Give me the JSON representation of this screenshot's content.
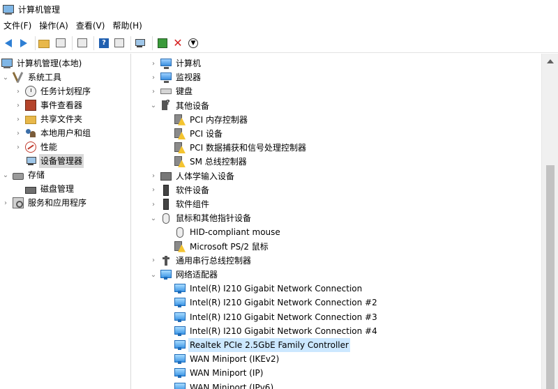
{
  "window": {
    "title": "计算机管理"
  },
  "menu": [
    "文件(F)",
    "操作(A)",
    "查看(V)",
    "帮助(H)"
  ],
  "toolbar": {
    "buttons": [
      "back-icon",
      "forward-icon",
      "up-folder-icon",
      "show-hide-tree-icon",
      "properties-icon",
      "help-icon",
      "show-action-pane-icon",
      "monitor-icon",
      "update-driver-icon",
      "uninstall-icon",
      "download-icon"
    ]
  },
  "left_tree": {
    "root": "计算机管理(本地)",
    "system_tools": "系统工具",
    "task_scheduler": "任务计划程序",
    "event_viewer": "事件查看器",
    "shared_folders": "共享文件夹",
    "local_users": "本地用户和组",
    "performance": "性能",
    "device_manager": "设备管理器",
    "storage": "存储",
    "disk_management": "磁盘管理",
    "services_apps": "服务和应用程序"
  },
  "device_tree": [
    {
      "label": "计算机",
      "level": 0,
      "expander": ">",
      "icon": "computer-monitor-icon"
    },
    {
      "label": "监视器",
      "level": 0,
      "expander": ">",
      "icon": "monitor-icon"
    },
    {
      "label": "键盘",
      "level": 0,
      "expander": ">",
      "icon": "keyboard-icon"
    },
    {
      "label": "其他设备",
      "level": 0,
      "expander": "v",
      "icon": "other-devices-icon"
    },
    {
      "label": "PCI 内存控制器",
      "level": 1,
      "expander": "",
      "icon": "warning-device-icon"
    },
    {
      "label": "PCI 设备",
      "level": 1,
      "expander": "",
      "icon": "warning-device-icon"
    },
    {
      "label": "PCI 数据捕获和信号处理控制器",
      "level": 1,
      "expander": "",
      "icon": "warning-device-icon"
    },
    {
      "label": "SM 总线控制器",
      "level": 1,
      "expander": "",
      "icon": "warning-device-icon"
    },
    {
      "label": "人体学输入设备",
      "level": 0,
      "expander": ">",
      "icon": "hid-icon"
    },
    {
      "label": "软件设备",
      "level": 0,
      "expander": ">",
      "icon": "software-device-icon"
    },
    {
      "label": "软件组件",
      "level": 0,
      "expander": ">",
      "icon": "software-component-icon"
    },
    {
      "label": "鼠标和其他指针设备",
      "level": 0,
      "expander": "v",
      "icon": "mouse-icon"
    },
    {
      "label": "HID-compliant mouse",
      "level": 1,
      "expander": "",
      "icon": "mouse-icon"
    },
    {
      "label": "Microsoft PS/2 鼠标",
      "level": 1,
      "expander": "",
      "icon": "warning-mouse-icon"
    },
    {
      "label": "通用串行总线控制器",
      "level": 0,
      "expander": ">",
      "icon": "usb-icon"
    },
    {
      "label": "网络适配器",
      "level": 0,
      "expander": "v",
      "icon": "network-adapter-icon"
    },
    {
      "label": "Intel(R) I210 Gigabit Network Connection",
      "level": 1,
      "expander": "",
      "icon": "network-adapter-icon"
    },
    {
      "label": "Intel(R) I210 Gigabit Network Connection #2",
      "level": 1,
      "expander": "",
      "icon": "network-adapter-icon"
    },
    {
      "label": "Intel(R) I210 Gigabit Network Connection #3",
      "level": 1,
      "expander": "",
      "icon": "network-adapter-icon"
    },
    {
      "label": "Intel(R) I210 Gigabit Network Connection #4",
      "level": 1,
      "expander": "",
      "icon": "network-adapter-icon"
    },
    {
      "label": "Realtek PCIe 2.5GbE Family Controller",
      "level": 1,
      "expander": "",
      "icon": "network-adapter-icon",
      "highlighted": true
    },
    {
      "label": "WAN Miniport (IKEv2)",
      "level": 1,
      "expander": "",
      "icon": "network-adapter-icon"
    },
    {
      "label": "WAN Miniport (IP)",
      "level": 1,
      "expander": "",
      "icon": "network-adapter-icon"
    },
    {
      "label": "WAN Miniport (IPv6)",
      "level": 1,
      "expander": "",
      "icon": "network-adapter-icon"
    }
  ],
  "colors": {
    "selection": "#d9d9d9",
    "highlight": "#cce8ff",
    "accent": "#2e7fd4",
    "warning": "#f4c430"
  }
}
